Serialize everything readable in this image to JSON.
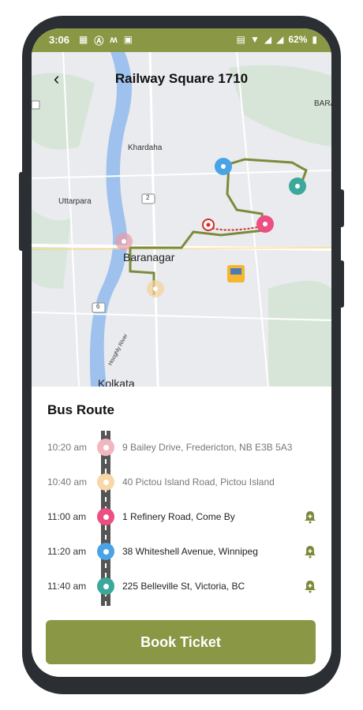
{
  "status_bar": {
    "time": "3:06",
    "battery": "62%",
    "left_icons": [
      "calendar-icon",
      "a-icon",
      "m-icon",
      "image-icon"
    ],
    "right_icons": [
      "volte-icon",
      "wifi-icon",
      "signal-icon",
      "signal-icon",
      "battery-icon"
    ]
  },
  "header": {
    "title": "Railway Square 1710",
    "back_icon": "back-arrow-icon"
  },
  "map": {
    "labels": [
      "Khardaha",
      "Uttarpara",
      "Baranagar",
      "Kolkata",
      "BARA",
      "Hooghly River",
      "2",
      "6"
    ],
    "pin_colors": [
      "#e99aa8",
      "#f5d19a",
      "#ec4f82",
      "#4aa3e6",
      "#3aa89a"
    ],
    "route_color": "#7b8a3a"
  },
  "route": {
    "title": "Bus Route",
    "stops": [
      {
        "time": "10:20 am",
        "address": "9 Bailey Drive, Fredericton, NB E3B 5A3",
        "status": "past",
        "color": "#f2b6c0"
      },
      {
        "time": "10:40 am",
        "address": "40 Pictou Island Road, Pictou Island",
        "status": "past",
        "color": "#f7d7a6"
      },
      {
        "time": "11:00 am",
        "address": "1 Refinery Road, Come By",
        "status": "upcoming",
        "color": "#ec4f82"
      },
      {
        "time": "11:20 am",
        "address": "38 Whiteshell Avenue, Winnipeg",
        "status": "upcoming",
        "color": "#4aa3e6"
      },
      {
        "time": "11:40 am",
        "address": "225 Belleville St, Victoria, BC",
        "status": "upcoming",
        "color": "#3aa89a"
      }
    ]
  },
  "actions": {
    "book_ticket": "Book Ticket"
  },
  "colors": {
    "accent": "#8a9845"
  }
}
